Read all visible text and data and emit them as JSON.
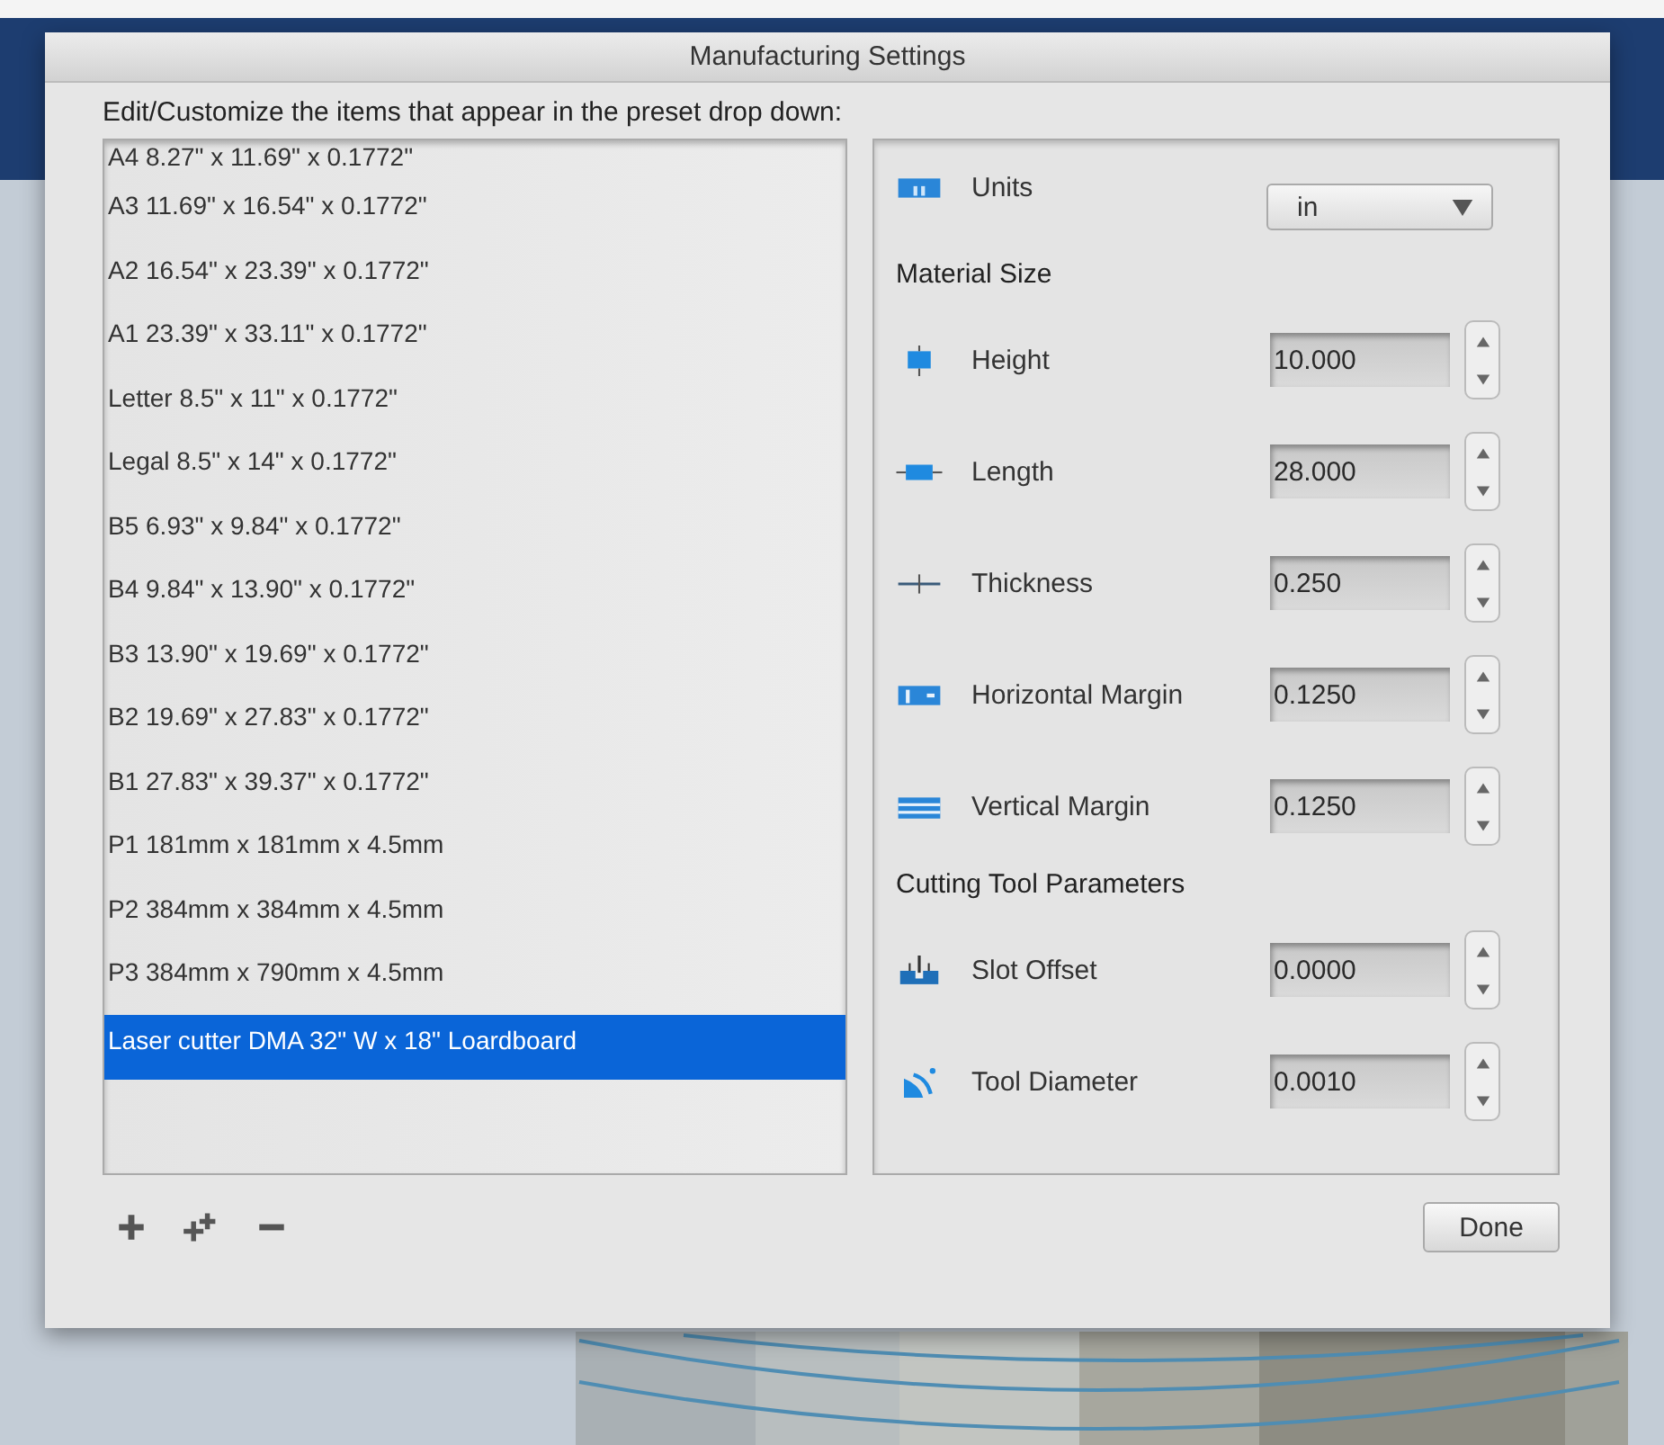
{
  "window": {
    "title": "Manufacturing Settings"
  },
  "instruction": "Edit/Customize the items that appear in the preset drop down:",
  "presets": [
    {
      "label": "A4 8.27\" x 11.69\" x 0.1772\"",
      "selected": false
    },
    {
      "label": "A3 11.69\" x 16.54\" x 0.1772\"",
      "selected": false
    },
    {
      "label": "A2 16.54\" x 23.39\" x 0.1772\"",
      "selected": false
    },
    {
      "label": "A1 23.39\" x 33.11\" x 0.1772\"",
      "selected": false
    },
    {
      "label": "Letter 8.5\" x 11\" x 0.1772\"",
      "selected": false
    },
    {
      "label": "Legal 8.5\" x 14\" x 0.1772\"",
      "selected": false
    },
    {
      "label": "B5 6.93\" x 9.84\" x 0.1772\"",
      "selected": false
    },
    {
      "label": "B4 9.84\" x 13.90\" x 0.1772\"",
      "selected": false
    },
    {
      "label": "B3 13.90\" x 19.69\" x 0.1772\"",
      "selected": false
    },
    {
      "label": "B2 19.69\" x 27.83\" x 0.1772\"",
      "selected": false
    },
    {
      "label": "B1 27.83\" x 39.37\" x 0.1772\"",
      "selected": false
    },
    {
      "label": "P1 181mm x 181mm x 4.5mm",
      "selected": false
    },
    {
      "label": "P2 384mm x 384mm x 4.5mm",
      "selected": false
    },
    {
      "label": "P3 384mm x 790mm x 4.5mm",
      "selected": false
    },
    {
      "label": "Laser cutter DMA 32\" W x 18\" Loardboard",
      "selected": true
    }
  ],
  "settings": [
    {
      "kind": "select",
      "label": "Units",
      "value": "in"
    },
    {
      "kind": "heading",
      "label": "Material Size"
    },
    {
      "kind": "number",
      "label": "Height",
      "value": "10.000"
    },
    {
      "kind": "number",
      "label": "Length",
      "value": "28.000"
    },
    {
      "kind": "number",
      "label": "Thickness",
      "value": "0.250"
    },
    {
      "kind": "number",
      "label": "Horizontal Margin",
      "value": "0.1250"
    },
    {
      "kind": "number",
      "label": "Vertical Margin",
      "value": "0.1250"
    },
    {
      "kind": "heading",
      "label": "Cutting Tool Parameters"
    },
    {
      "kind": "number",
      "label": "Slot Offset",
      "value": "0.0000"
    },
    {
      "kind": "number",
      "label": "Tool Diameter",
      "value": "0.0010"
    }
  ],
  "done_button": "Done"
}
